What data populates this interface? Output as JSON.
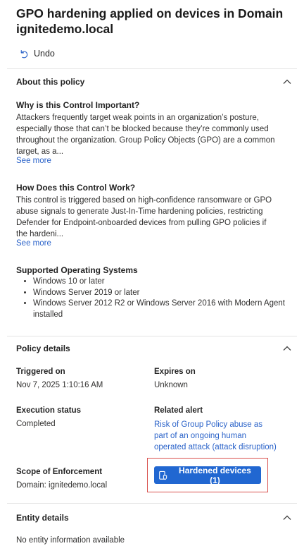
{
  "title": "GPO hardening applied on devices in Domain ignitedemo.local",
  "undo_label": "Undo",
  "about": {
    "header": "About this policy",
    "why_heading": "Why is this Control Important?",
    "why_text": "Attackers frequently target weak points in an organization’s posture, especially those that can’t be blocked because they’re commonly used throughout the organization. Group Policy Objects (GPO) are a common target, as a...",
    "why_see_more": "See more",
    "how_heading": "How Does this Control Work?",
    "how_text": "This control is triggered based on high-confidence ransomware or GPO abuse signals to generate Just-In-Time hardening policies, restricting Defender for Endpoint-onboarded devices from pulling GPO policies if the hardeni...",
    "how_see_more": "See more",
    "os_heading": "Supported Operating Systems",
    "os_items": [
      "Windows 10 or later",
      "Windows Server 2019 or later",
      "Windows Server 2012 R2 or Windows Server 2016 with Modern Agent installed"
    ]
  },
  "policy": {
    "header": "Policy details",
    "triggered_label": "Triggered on",
    "triggered_value": "Nov 7, 2025 1:10:16 AM",
    "expires_label": "Expires on",
    "expires_value": "Unknown",
    "exec_label": "Execution status",
    "exec_value": "Completed",
    "alert_label": "Related alert",
    "alert_value": "Risk of Group Policy abuse as part of an ongoing human operated attack (attack disruption)",
    "scope_label": "Scope of Enforcement",
    "scope_value": "Domain: ignitedemo.local",
    "hardened_button": "Hardened devices (1)"
  },
  "entity": {
    "header": "Entity details",
    "empty_text": "No entity information available"
  },
  "colors": {
    "link": "#2b63c9",
    "primary_button": "#2167d1",
    "highlight_box": "#d9534f"
  },
  "icons": {
    "undo": "undo-icon",
    "chevron": "chevron-up-icon",
    "device": "devices-icon"
  }
}
